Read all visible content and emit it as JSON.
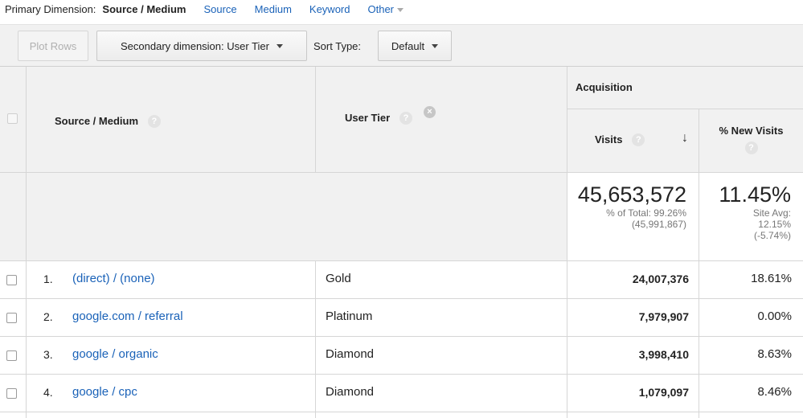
{
  "primary_dimension": {
    "label": "Primary Dimension:",
    "active": "Source / Medium",
    "options": [
      "Source",
      "Medium",
      "Keyword"
    ],
    "other": "Other"
  },
  "toolbar": {
    "plot_rows": "Plot Rows",
    "secondary_dimension": "Secondary dimension: User Tier",
    "sort_type_label": "Sort Type:",
    "sort_type_value": "Default"
  },
  "table": {
    "columns": {
      "source_medium": "Source / Medium",
      "user_tier": "User Tier",
      "group_acquisition": "Acquisition",
      "visits": "Visits",
      "new_visits": "% New Visits"
    },
    "help_glyph": "?",
    "close_glyph": "×",
    "sort_arrow": "↓",
    "totals": {
      "visits": "45,653,572",
      "visits_sub_1": "% of Total: 99.26%",
      "visits_sub_2": "(45,991,867)",
      "new_visits": "11.45%",
      "new_visits_sub_1": "Site Avg:",
      "new_visits_sub_2": "12.15%",
      "new_visits_sub_3": "(-5.74%)"
    },
    "rows": [
      {
        "num": "1.",
        "source": "(direct) / (none)",
        "tier": "Gold",
        "visits": "24,007,376",
        "new_visits": "18.61%"
      },
      {
        "num": "2.",
        "source": "google.com / referral",
        "tier": "Platinum",
        "visits": "7,979,907",
        "new_visits": "0.00%"
      },
      {
        "num": "3.",
        "source": "google / organic",
        "tier": "Diamond",
        "visits": "3,998,410",
        "new_visits": "8.63%"
      },
      {
        "num": "4.",
        "source": "google / cpc",
        "tier": "Diamond",
        "visits": "1,079,097",
        "new_visits": "8.46%"
      }
    ]
  },
  "colors": {
    "link": "#1a62b8",
    "header_bg": "#f1f1f1",
    "border": "#d6d6d6"
  }
}
